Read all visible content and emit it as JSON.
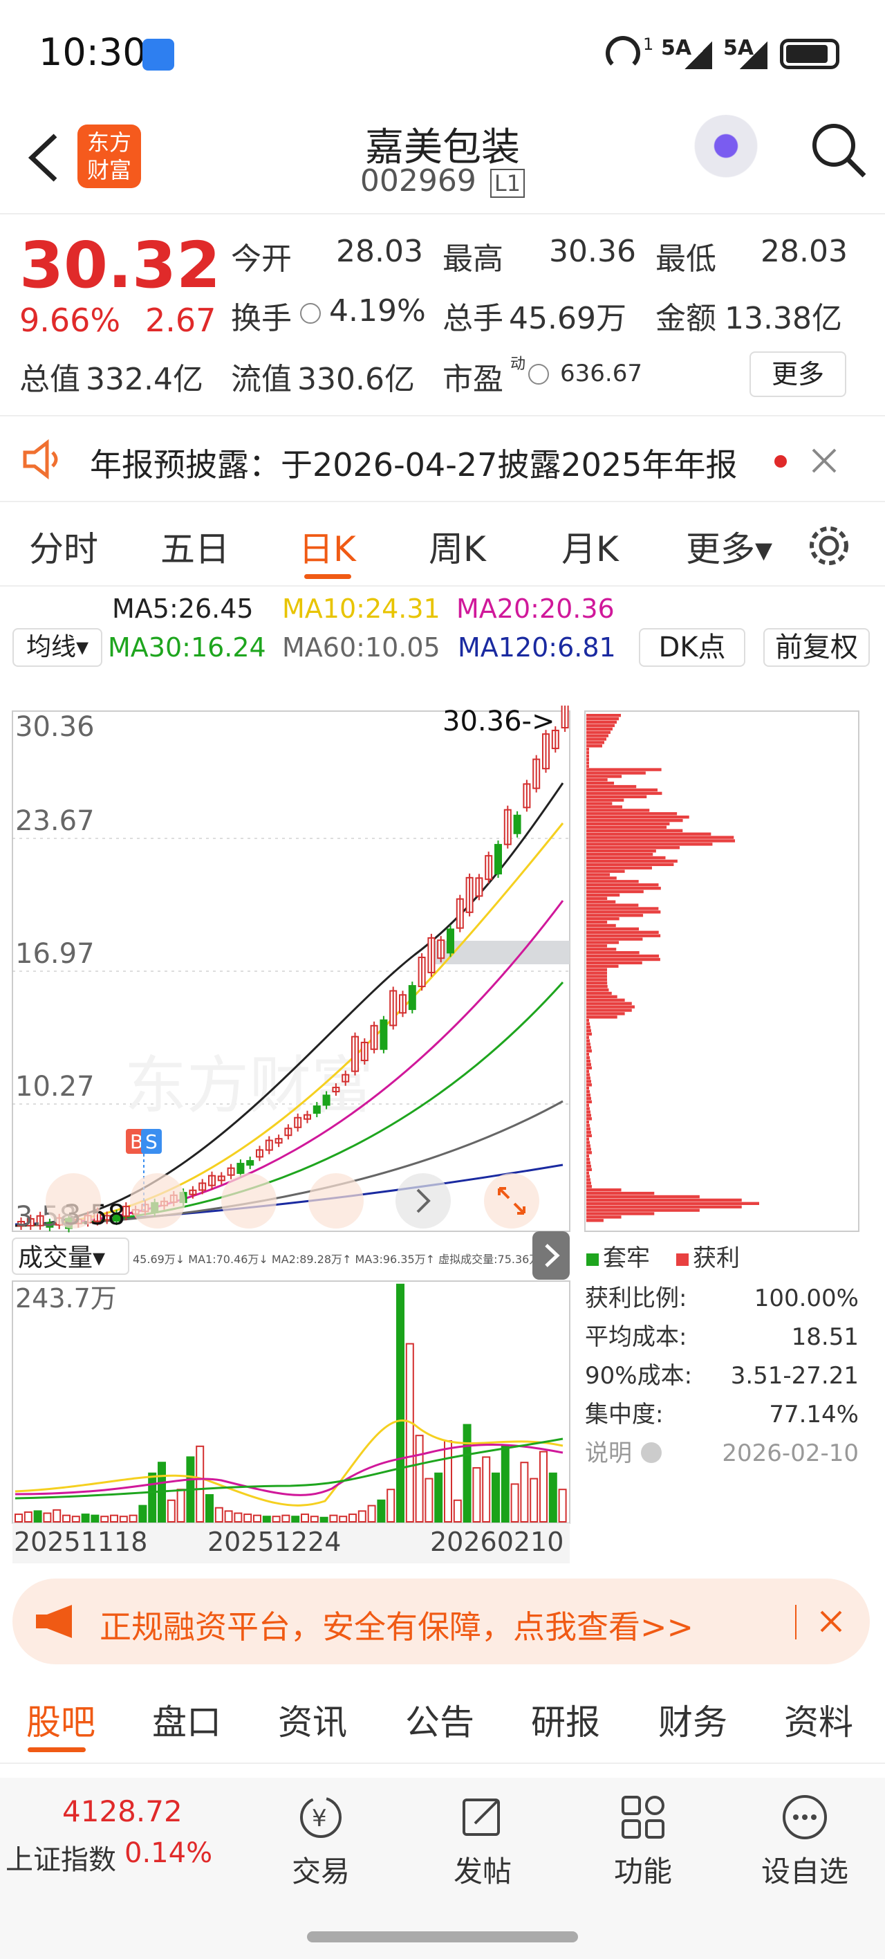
{
  "status_bar": {
    "time": "10:30",
    "signal1": "5A",
    "signal2": "5A",
    "sup": "1"
  },
  "header": {
    "logo_text": "东方\n财富",
    "stock_name": "嘉美包装",
    "stock_code": "002969",
    "code_badge": "L1"
  },
  "quote": {
    "price": "30.32",
    "change_pct": "9.66%",
    "change_amt": "2.67",
    "open_label": "今开",
    "open_value": "28.03",
    "high_label": "最高",
    "high_value": "30.36",
    "low_label": "最低",
    "low_value": "28.03",
    "turnover_label": "换手",
    "turnover_value": "4.19%",
    "volume_label": "总手",
    "volume_value": "45.69万",
    "amount_label": "金额",
    "amount_value": "13.38亿",
    "mktcap_label": "总值",
    "mktcap_value": "332.4亿",
    "float_label": "流值",
    "float_value": "330.6亿",
    "pe_label": "市盈",
    "pe_sup": "动",
    "pe_value": "636.67",
    "more_button": "更多"
  },
  "notice": {
    "text": "年报预披露：于2026-04-27披露2025年年报"
  },
  "period_tabs": [
    "分时",
    "五日",
    "日K",
    "周K",
    "月K",
    "更多▾"
  ],
  "active_tab": "日K",
  "ma": {
    "ma5": "MA5:26.45",
    "ma10": "MA10:24.31",
    "ma20": "MA20:20.36",
    "selector": "均线▾",
    "ma30": "MA30:16.24",
    "ma60": "MA60:10.05",
    "ma120": "MA120:6.81",
    "dk_button": "DK点",
    "adj_button": "前复权",
    "colors": {
      "ma5": "#222222",
      "ma10": "#f5d020",
      "ma20": "#d0189a",
      "ma30": "#1ea51e",
      "ma60": "#666666",
      "ma120": "#1a2aa0"
    }
  },
  "kline": {
    "y_labels": [
      "30.36",
      "23.67",
      "16.97",
      "10.27",
      "3.58"
    ],
    "max_marker": "30.36->",
    "min_marker": "3.58",
    "bs_marker_b": "B",
    "bs_marker_s": "S"
  },
  "volume": {
    "selector": "成交量▾",
    "legend": "45.69万↓ MA1:70.46万↓ MA2:89.28万↑ MA3:96.35万↑ 虚拟成交量:75.36万",
    "max_label": "243.7万",
    "x_labels": [
      "20251118",
      "20251224",
      "20260210"
    ]
  },
  "chip": {
    "legend_trapped": "套牢",
    "legend_profit": "获利",
    "rows": [
      {
        "label": "获利比例:",
        "value": "100.00%"
      },
      {
        "label": "平均成本:",
        "value": "18.51"
      },
      {
        "label": "90%成本:",
        "value": "3.51-27.21"
      },
      {
        "label": "集中度:",
        "value": "77.14%"
      }
    ],
    "note_label": "说明",
    "date": "2026-02-10"
  },
  "ad": {
    "text": "正规融资平台，安全有保障，点我查看>>"
  },
  "bottom_tabs": [
    "股吧",
    "盘口",
    "资讯",
    "公告",
    "研报",
    "财务",
    "资料"
  ],
  "active_bottom_tab": "股吧",
  "nav": {
    "index_value": "4128.72",
    "index_name": "上证指数",
    "index_change": "0.14%",
    "items": [
      "交易",
      "发帖",
      "功能",
      "设自选"
    ]
  }
}
